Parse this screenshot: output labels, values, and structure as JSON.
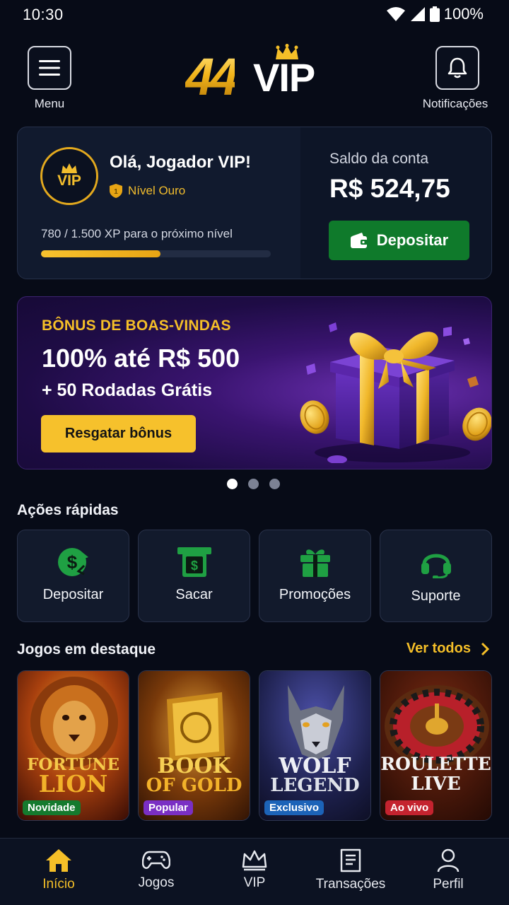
{
  "status_bar": {
    "time": "10:30",
    "battery": "100%"
  },
  "header": {
    "menu_label": "Menu",
    "notifications_label": "Notificações",
    "logo_number": "44",
    "logo_word": "VIP"
  },
  "account": {
    "badge": "VIP",
    "greeting": "Olá, Jogador VIP!",
    "level": "Nível Ouro",
    "xp_text": "780 / 1.500 XP para o próximo nível",
    "xp_progress": 0.52,
    "balance_label": "Saldo da conta",
    "balance_value": "R$ 524,75",
    "deposit_label": "Depositar"
  },
  "promo": {
    "eyebrow": "BÔNUS DE BOAS-VINDAS",
    "title": "100% até R$ 500",
    "subtitle": "+ 50 Rodadas Grátis",
    "button": "Resgatar bônus",
    "carousel_pages": 3,
    "carousel_active": 1
  },
  "quick_actions": {
    "title": "Ações rápidas",
    "items": [
      {
        "label": "Depositar",
        "icon": "money-deposit-icon"
      },
      {
        "label": "Sacar",
        "icon": "cash-withdraw-icon"
      },
      {
        "label": "Promoções",
        "icon": "gift-icon"
      },
      {
        "label": "Suporte",
        "icon": "headset-icon"
      }
    ]
  },
  "featured": {
    "title": "Jogos em destaque",
    "see_all": "Ver todos",
    "games": [
      {
        "line1": "FORTUNE",
        "line2": "LION",
        "tag": "Novidade",
        "tag_color": "#157a2e"
      },
      {
        "line1": "BOOK",
        "line2": "OF GOLD",
        "tag": "Popular",
        "tag_color": "#7a2fc4"
      },
      {
        "line1": "WOLF",
        "line2": "LEGEND",
        "tag": "Exclusivo",
        "tag_color": "#1c63b8"
      },
      {
        "line1": "ROULETTE",
        "line2": "LIVE",
        "tag": "Ao vivo",
        "tag_color": "#c4232f"
      }
    ]
  },
  "bottom_nav": {
    "items": [
      {
        "label": "Início",
        "icon": "home-icon",
        "active": true
      },
      {
        "label": "Jogos",
        "icon": "gamepad-icon",
        "active": false
      },
      {
        "label": "VIP",
        "icon": "crown-icon",
        "active": false
      },
      {
        "label": "Transações",
        "icon": "receipt-icon",
        "active": false
      },
      {
        "label": "Perfil",
        "icon": "user-icon",
        "active": false
      }
    ]
  },
  "colors": {
    "accent_gold": "#f5bf28",
    "deposit_green": "#0f7a2b",
    "background": "#070b17"
  }
}
